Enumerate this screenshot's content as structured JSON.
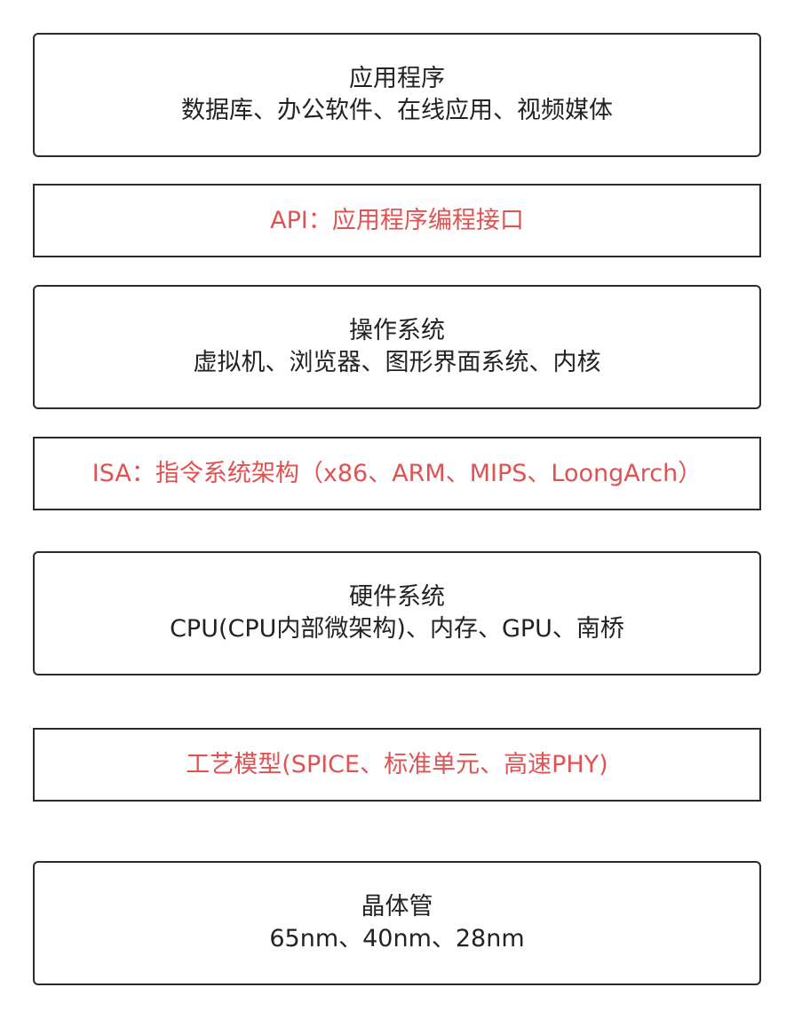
{
  "layers": {
    "applications": {
      "title": "应用程序",
      "desc": "数据库、办公软件、在线应用、视频媒体"
    },
    "api": {
      "text": "API：应用程序编程接口",
      "color": "#e05252"
    },
    "os": {
      "title": "操作系统",
      "desc": "虚拟机、浏览器、图形界面系统、内核"
    },
    "isa": {
      "text": "ISA：指令系统架构（x86、ARM、MIPS、LoongArch）",
      "color": "#e05252"
    },
    "hardware": {
      "title": "硬件系统",
      "desc": "CPU(CPU内部微架构)、内存、GPU、南桥"
    },
    "process": {
      "text": "工艺模型(SPICE、标准单元、高速PHY)",
      "color": "#e05252"
    },
    "transistor": {
      "title": "晶体管",
      "desc": "65nm、40nm、28nm"
    }
  },
  "colors": {
    "text": "#222222",
    "border": "#2b2b2b",
    "interface_text": "#e05252"
  }
}
